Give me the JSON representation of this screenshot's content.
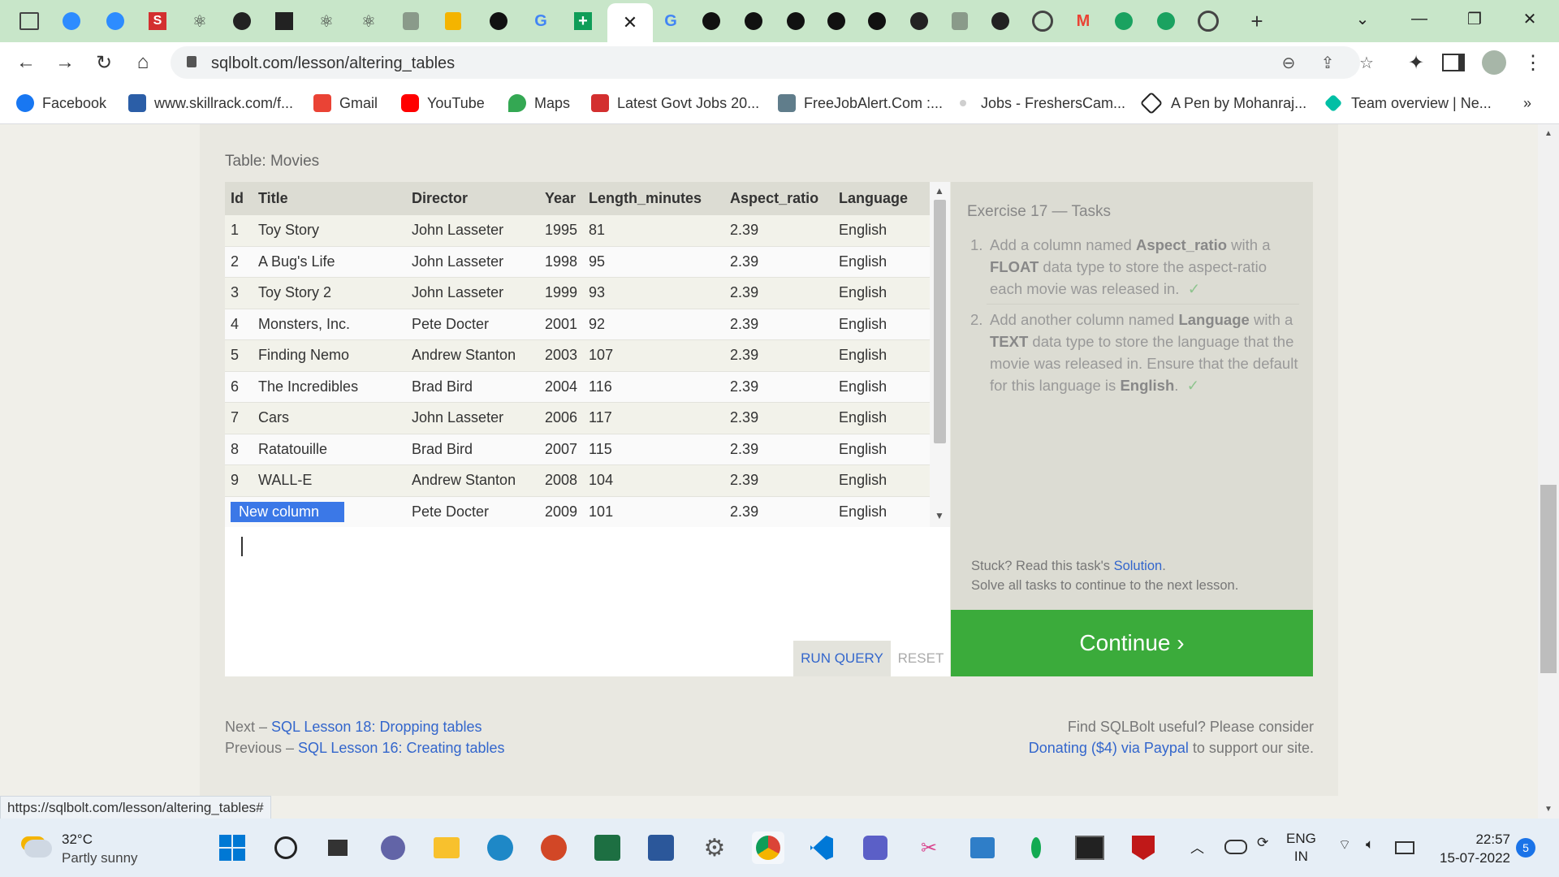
{
  "browser": {
    "active_tab_close": "✕",
    "url": "sqlbolt.com/lesson/altering_tables",
    "bookmarks": [
      {
        "label": "Facebook",
        "color": "#1877f2"
      },
      {
        "label": "www.skillrack.com/f...",
        "color": "#2b5ea7"
      },
      {
        "label": "Gmail",
        "color": "#ea4335"
      },
      {
        "label": "YouTube",
        "color": "#ff0000"
      },
      {
        "label": "Maps",
        "color": "#34a853"
      },
      {
        "label": "Latest Govt Jobs 20...",
        "color": "#d32f2f"
      },
      {
        "label": "FreeJobAlert.Com :...",
        "color": "#607d8b"
      },
      {
        "label": "Jobs - FreshersCam...",
        "color": "#9e9e9e"
      },
      {
        "label": "A Pen by Mohanraj...",
        "color": "#222222"
      },
      {
        "label": "Team overview | Ne...",
        "color": "#00bfa5"
      }
    ],
    "bookmarks_more": "»"
  },
  "lesson": {
    "table_caption": "Table: Movies",
    "columns": [
      "Id",
      "Title",
      "Director",
      "Year",
      "Length_minutes",
      "Aspect_ratio",
      "Language"
    ],
    "rows": [
      [
        "1",
        "Toy Story",
        "John Lasseter",
        "1995",
        "81",
        "2.39",
        "English"
      ],
      [
        "2",
        "A Bug's Life",
        "John Lasseter",
        "1998",
        "95",
        "2.39",
        "English"
      ],
      [
        "3",
        "Toy Story 2",
        "John Lasseter",
        "1999",
        "93",
        "2.39",
        "English"
      ],
      [
        "4",
        "Monsters, Inc.",
        "Pete Docter",
        "2001",
        "92",
        "2.39",
        "English"
      ],
      [
        "5",
        "Finding Nemo",
        "Andrew Stanton",
        "2003",
        "107",
        "2.39",
        "English"
      ],
      [
        "6",
        "The Incredibles",
        "Brad Bird",
        "2004",
        "116",
        "2.39",
        "English"
      ],
      [
        "7",
        "Cars",
        "John Lasseter",
        "2006",
        "117",
        "2.39",
        "English"
      ],
      [
        "8",
        "Ratatouille",
        "Brad Bird",
        "2007",
        "115",
        "2.39",
        "English"
      ],
      [
        "9",
        "WALL-E",
        "Andrew Stanton",
        "2008",
        "104",
        "2.39",
        "English"
      ]
    ],
    "last_row": {
      "selected_text": "New column",
      "director": "Pete Docter",
      "year": "2009",
      "length": "101",
      "aspect": "2.39",
      "language": "English"
    },
    "run_query": "RUN QUERY",
    "reset": "RESET",
    "exercise_title": "Exercise 17 — Tasks",
    "task1": {
      "num": "1.",
      "pre": "Add a column named ",
      "bold1": "Aspect_ratio",
      "mid": " with a ",
      "bold2": "FLOAT",
      "post": " data type to store the aspect-ratio each movie was released in.",
      "check": "✓"
    },
    "task2": {
      "num": "2.",
      "pre": "Add another column named ",
      "bold1": "Language",
      "mid": " with a ",
      "bold2": "TEXT",
      "post": " data type to store the language that the movie was released in. Ensure that the default for this language is ",
      "bold3": "English",
      "end": ".",
      "check": "✓"
    },
    "stuck_pre": "Stuck? Read this task's ",
    "stuck_link": "Solution",
    "stuck_post": ".",
    "solve_all": "Solve all tasks to continue to the next lesson.",
    "continue": "Continue ›",
    "next_pre": "Next – ",
    "next_link": "SQL Lesson 18: Dropping tables",
    "prev_pre": "Previous – ",
    "prev_link": "SQL Lesson 16: Creating tables",
    "find_useful": "Find SQLBolt useful? Please consider",
    "donate_link": "Donating ($4) via Paypal",
    "donate_post": " to support our site."
  },
  "status_url": "https://sqlbolt.com/lesson/altering_tables#",
  "taskbar": {
    "temperature": "32°C",
    "weather": "Partly sunny",
    "lang1": "ENG",
    "lang2": "IN",
    "time": "22:57",
    "date": "15-07-2022",
    "notifications": "5"
  }
}
